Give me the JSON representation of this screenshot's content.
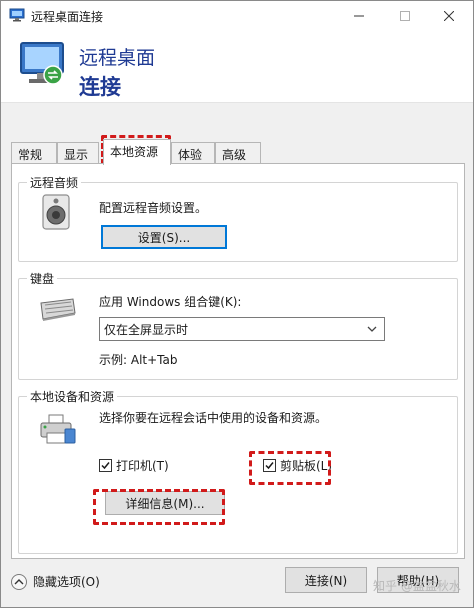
{
  "window": {
    "title": "远程桌面连接",
    "controls": {
      "minimize": "—",
      "maximize": "☐",
      "close": "✕"
    }
  },
  "banner": {
    "line1": "远程桌面",
    "line2": "连接",
    "icon": "remote-desktop-icon"
  },
  "tabs": [
    {
      "label": "常规"
    },
    {
      "label": "显示"
    },
    {
      "label": "本地资源",
      "active": true
    },
    {
      "label": "体验"
    },
    {
      "label": "高级"
    }
  ],
  "audio": {
    "group_title": "远程音频",
    "description": "配置远程音频设置。",
    "settings_button": "设置(S)...",
    "icon": "speaker-icon"
  },
  "keyboard": {
    "group_title": "键盘",
    "label": "应用 Windows 组合键(K):",
    "selected": "仅在全屏显示时",
    "example": "示例: Alt+Tab",
    "icon": "keyboard-icon"
  },
  "local": {
    "group_title": "本地设备和资源",
    "description": "选择你要在远程会话中使用的设备和资源。",
    "printer_label": "打印机(T)",
    "printer_checked": true,
    "clipboard_label": "剪贴板(L)",
    "clipboard_checked": true,
    "details_button": "详细信息(M)...",
    "icon": "printer-devices-icon"
  },
  "footer": {
    "hide_options": "隐藏选项(O)",
    "connect": "连接(N)",
    "help": "帮助(H)",
    "watermark": "知乎 @盆盆秋水"
  },
  "colors": {
    "accent": "#0078d7",
    "title_blue": "#1f3a93",
    "highlight": "#d11a1a"
  }
}
